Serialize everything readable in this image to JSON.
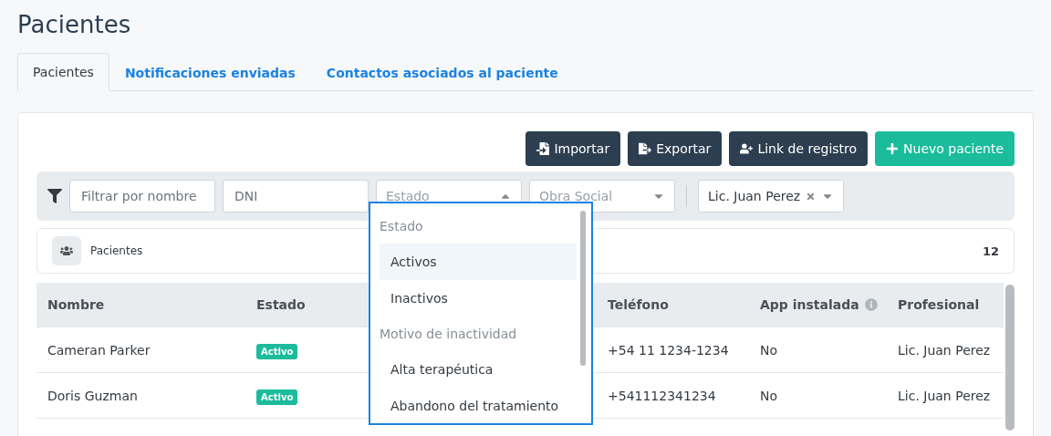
{
  "page_title": "Pacientes",
  "tabs": [
    {
      "label": "Pacientes",
      "selected": true
    },
    {
      "label": "Notificaciones enviadas",
      "selected": false
    },
    {
      "label": "Contactos asociados al paciente",
      "selected": false
    }
  ],
  "actions": [
    {
      "label": "Importar",
      "kind": "import"
    },
    {
      "label": "Exportar",
      "kind": "export"
    },
    {
      "label": "Link de registro",
      "kind": "link"
    },
    {
      "label": "Nuevo paciente",
      "kind": "new"
    }
  ],
  "filters": {
    "name": {
      "placeholder": "Filtrar por nombre"
    },
    "dni": {
      "placeholder": "DNI"
    },
    "estado": {
      "placeholder": "Estado",
      "expanded": true
    },
    "obra_social": {
      "placeholder": "Obra Social",
      "expanded": false
    },
    "profesional": {
      "value": "Lic. Juan Perez"
    }
  },
  "estado_menu": [
    {
      "kind": "group",
      "label": "Estado"
    },
    {
      "kind": "option",
      "label": "Activos",
      "selected": true
    },
    {
      "kind": "option",
      "label": "Inactivos",
      "selected": false
    },
    {
      "kind": "group",
      "label": "Motivo de inactividad"
    },
    {
      "kind": "option",
      "label": "Alta terapéutica",
      "selected": false
    },
    {
      "kind": "option",
      "label": "Abandono del tratamiento",
      "selected": false
    }
  ],
  "summary": {
    "label": "Pacientes",
    "count": "12"
  },
  "table": {
    "columns": [
      "Nombre",
      "Estado",
      "Teléfono",
      "App instalada",
      "Profesional"
    ],
    "rows": [
      {
        "nombre": "Cameran Parker",
        "estado": "Activo",
        "telefono": "+54 11 1234-1234",
        "app": "No",
        "profesional": "Lic. Juan Perez"
      },
      {
        "nombre": "Doris Guzman",
        "estado": "Activo",
        "telefono": "+541112341234",
        "app": "No",
        "profesional": "Lic. Juan Perez"
      }
    ]
  }
}
